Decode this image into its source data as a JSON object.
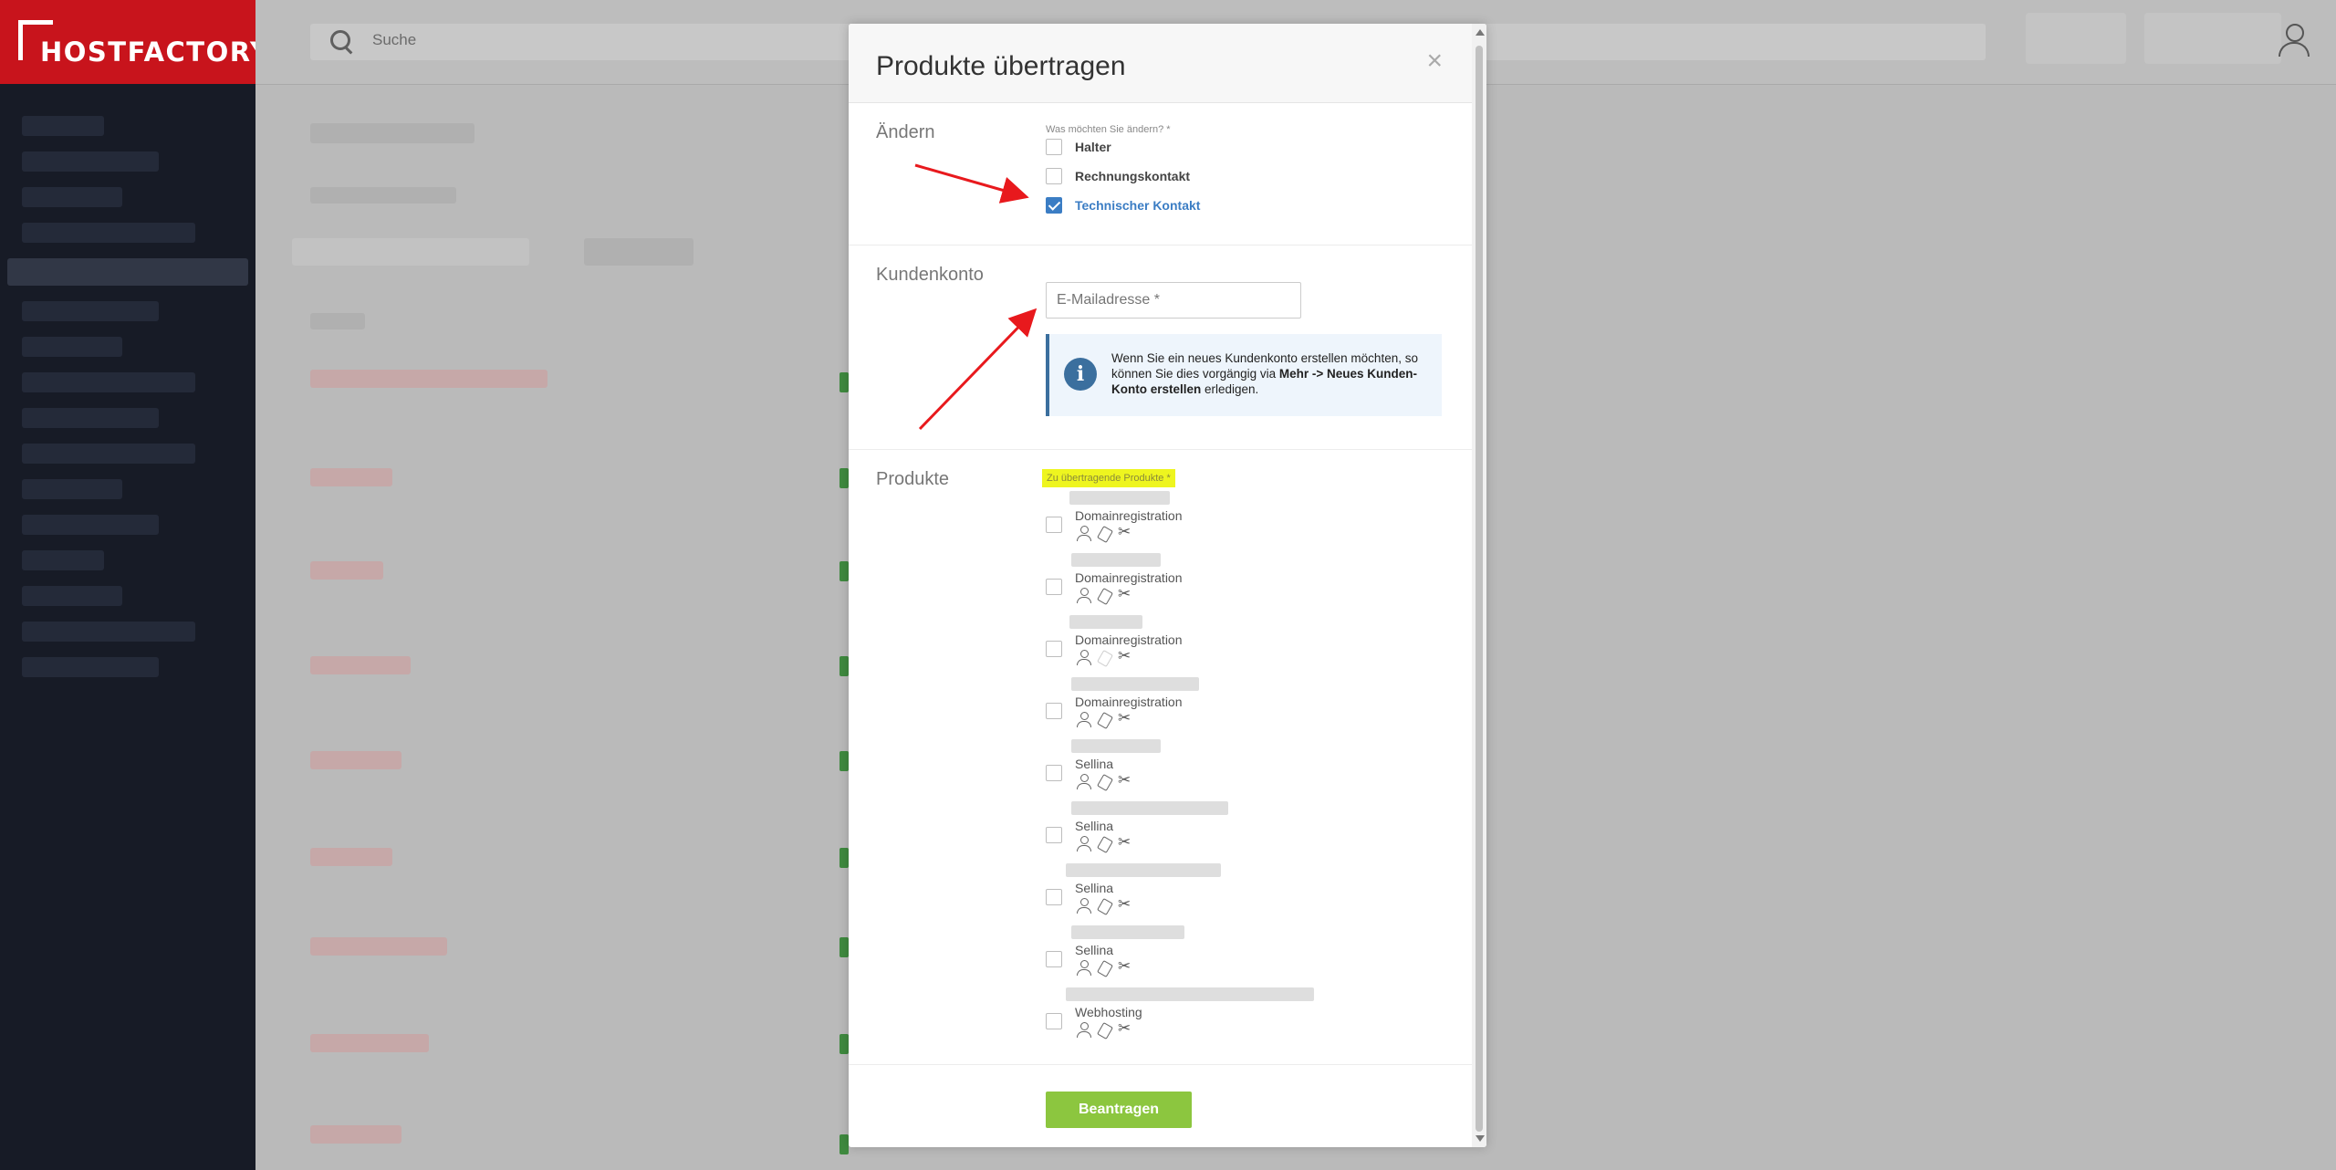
{
  "app": {
    "logo_text": "HOSTFACTORY"
  },
  "search": {
    "placeholder": "Suche"
  },
  "modal": {
    "title": "Produkte übertragen",
    "close_label": "×",
    "aendern": {
      "section_label": "Ändern",
      "question": "Was möchten Sie ändern? *",
      "options": [
        {
          "label": "Halter",
          "checked": false
        },
        {
          "label": "Rechnungskontakt",
          "checked": false
        },
        {
          "label": "Technischer Kontakt",
          "checked": true
        }
      ]
    },
    "kundenkonto": {
      "section_label": "Kundenkonto",
      "email_placeholder": "E-Mailadresse *",
      "info_text_1": "Wenn Sie ein neues Kundenkonto erstellen möchten, so können Sie dies vorgängig via ",
      "info_bold": "Mehr -> Neues Kunden-Konto erstellen",
      "info_text_2": " erledigen.",
      "info_icon": "i"
    },
    "produkte": {
      "section_label": "Produkte",
      "field_label": "Zu übertragende Produkte *",
      "items": [
        {
          "type": "Domainregistration",
          "tag_faded": false
        },
        {
          "type": "Domainregistration",
          "tag_faded": false
        },
        {
          "type": "Domainregistration",
          "tag_faded": true
        },
        {
          "type": "Domainregistration",
          "tag_faded": false
        },
        {
          "type": "Sellina",
          "tag_faded": false
        },
        {
          "type": "Sellina",
          "tag_faded": false
        },
        {
          "type": "Sellina",
          "tag_faded": false
        },
        {
          "type": "Sellina",
          "tag_faded": false
        },
        {
          "type": "Webhosting",
          "tag_faded": false
        }
      ]
    },
    "submit_label": "Beantragen"
  },
  "colors": {
    "brand_red": "#c8141c",
    "submit_green": "#8cc63f",
    "accent_blue": "#3b7dc4",
    "highlight_yellow": "#eef51f",
    "annotation_red": "#e8191d"
  },
  "icons": [
    "search-icon",
    "user-icon",
    "close-icon",
    "info-icon",
    "person-icon",
    "tag-icon",
    "tools-icon",
    "checkmark-icon"
  ]
}
